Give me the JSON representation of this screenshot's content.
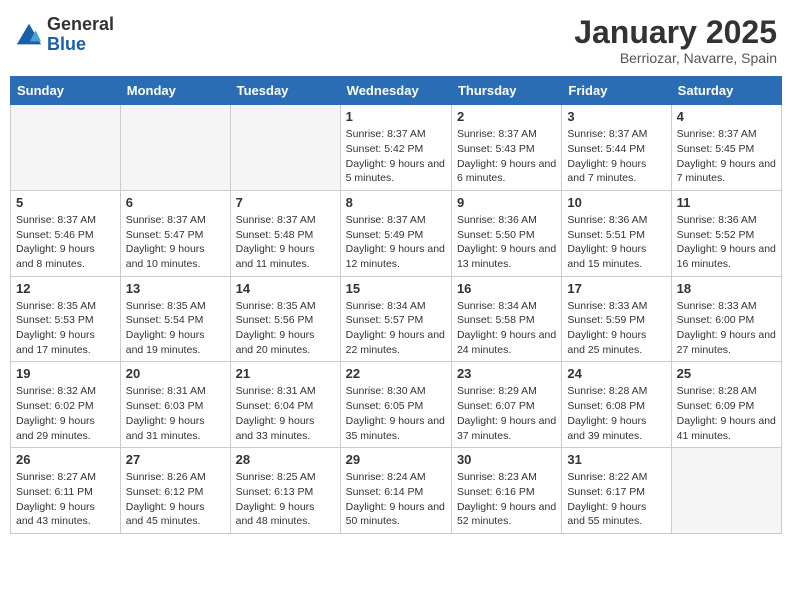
{
  "logo": {
    "general": "General",
    "blue": "Blue"
  },
  "title": "January 2025",
  "subtitle": "Berriozar, Navarre, Spain",
  "days": [
    "Sunday",
    "Monday",
    "Tuesday",
    "Wednesday",
    "Thursday",
    "Friday",
    "Saturday"
  ],
  "weeks": [
    [
      {
        "date": "",
        "sunrise": "",
        "sunset": "",
        "daylight": ""
      },
      {
        "date": "",
        "sunrise": "",
        "sunset": "",
        "daylight": ""
      },
      {
        "date": "",
        "sunrise": "",
        "sunset": "",
        "daylight": ""
      },
      {
        "date": "1",
        "sunrise": "Sunrise: 8:37 AM",
        "sunset": "Sunset: 5:42 PM",
        "daylight": "Daylight: 9 hours and 5 minutes."
      },
      {
        "date": "2",
        "sunrise": "Sunrise: 8:37 AM",
        "sunset": "Sunset: 5:43 PM",
        "daylight": "Daylight: 9 hours and 6 minutes."
      },
      {
        "date": "3",
        "sunrise": "Sunrise: 8:37 AM",
        "sunset": "Sunset: 5:44 PM",
        "daylight": "Daylight: 9 hours and 7 minutes."
      },
      {
        "date": "4",
        "sunrise": "Sunrise: 8:37 AM",
        "sunset": "Sunset: 5:45 PM",
        "daylight": "Daylight: 9 hours and 7 minutes."
      }
    ],
    [
      {
        "date": "5",
        "sunrise": "Sunrise: 8:37 AM",
        "sunset": "Sunset: 5:46 PM",
        "daylight": "Daylight: 9 hours and 8 minutes."
      },
      {
        "date": "6",
        "sunrise": "Sunrise: 8:37 AM",
        "sunset": "Sunset: 5:47 PM",
        "daylight": "Daylight: 9 hours and 10 minutes."
      },
      {
        "date": "7",
        "sunrise": "Sunrise: 8:37 AM",
        "sunset": "Sunset: 5:48 PM",
        "daylight": "Daylight: 9 hours and 11 minutes."
      },
      {
        "date": "8",
        "sunrise": "Sunrise: 8:37 AM",
        "sunset": "Sunset: 5:49 PM",
        "daylight": "Daylight: 9 hours and 12 minutes."
      },
      {
        "date": "9",
        "sunrise": "Sunrise: 8:36 AM",
        "sunset": "Sunset: 5:50 PM",
        "daylight": "Daylight: 9 hours and 13 minutes."
      },
      {
        "date": "10",
        "sunrise": "Sunrise: 8:36 AM",
        "sunset": "Sunset: 5:51 PM",
        "daylight": "Daylight: 9 hours and 15 minutes."
      },
      {
        "date": "11",
        "sunrise": "Sunrise: 8:36 AM",
        "sunset": "Sunset: 5:52 PM",
        "daylight": "Daylight: 9 hours and 16 minutes."
      }
    ],
    [
      {
        "date": "12",
        "sunrise": "Sunrise: 8:35 AM",
        "sunset": "Sunset: 5:53 PM",
        "daylight": "Daylight: 9 hours and 17 minutes."
      },
      {
        "date": "13",
        "sunrise": "Sunrise: 8:35 AM",
        "sunset": "Sunset: 5:54 PM",
        "daylight": "Daylight: 9 hours and 19 minutes."
      },
      {
        "date": "14",
        "sunrise": "Sunrise: 8:35 AM",
        "sunset": "Sunset: 5:56 PM",
        "daylight": "Daylight: 9 hours and 20 minutes."
      },
      {
        "date": "15",
        "sunrise": "Sunrise: 8:34 AM",
        "sunset": "Sunset: 5:57 PM",
        "daylight": "Daylight: 9 hours and 22 minutes."
      },
      {
        "date": "16",
        "sunrise": "Sunrise: 8:34 AM",
        "sunset": "Sunset: 5:58 PM",
        "daylight": "Daylight: 9 hours and 24 minutes."
      },
      {
        "date": "17",
        "sunrise": "Sunrise: 8:33 AM",
        "sunset": "Sunset: 5:59 PM",
        "daylight": "Daylight: 9 hours and 25 minutes."
      },
      {
        "date": "18",
        "sunrise": "Sunrise: 8:33 AM",
        "sunset": "Sunset: 6:00 PM",
        "daylight": "Daylight: 9 hours and 27 minutes."
      }
    ],
    [
      {
        "date": "19",
        "sunrise": "Sunrise: 8:32 AM",
        "sunset": "Sunset: 6:02 PM",
        "daylight": "Daylight: 9 hours and 29 minutes."
      },
      {
        "date": "20",
        "sunrise": "Sunrise: 8:31 AM",
        "sunset": "Sunset: 6:03 PM",
        "daylight": "Daylight: 9 hours and 31 minutes."
      },
      {
        "date": "21",
        "sunrise": "Sunrise: 8:31 AM",
        "sunset": "Sunset: 6:04 PM",
        "daylight": "Daylight: 9 hours and 33 minutes."
      },
      {
        "date": "22",
        "sunrise": "Sunrise: 8:30 AM",
        "sunset": "Sunset: 6:05 PM",
        "daylight": "Daylight: 9 hours and 35 minutes."
      },
      {
        "date": "23",
        "sunrise": "Sunrise: 8:29 AM",
        "sunset": "Sunset: 6:07 PM",
        "daylight": "Daylight: 9 hours and 37 minutes."
      },
      {
        "date": "24",
        "sunrise": "Sunrise: 8:28 AM",
        "sunset": "Sunset: 6:08 PM",
        "daylight": "Daylight: 9 hours and 39 minutes."
      },
      {
        "date": "25",
        "sunrise": "Sunrise: 8:28 AM",
        "sunset": "Sunset: 6:09 PM",
        "daylight": "Daylight: 9 hours and 41 minutes."
      }
    ],
    [
      {
        "date": "26",
        "sunrise": "Sunrise: 8:27 AM",
        "sunset": "Sunset: 6:11 PM",
        "daylight": "Daylight: 9 hours and 43 minutes."
      },
      {
        "date": "27",
        "sunrise": "Sunrise: 8:26 AM",
        "sunset": "Sunset: 6:12 PM",
        "daylight": "Daylight: 9 hours and 45 minutes."
      },
      {
        "date": "28",
        "sunrise": "Sunrise: 8:25 AM",
        "sunset": "Sunset: 6:13 PM",
        "daylight": "Daylight: 9 hours and 48 minutes."
      },
      {
        "date": "29",
        "sunrise": "Sunrise: 8:24 AM",
        "sunset": "Sunset: 6:14 PM",
        "daylight": "Daylight: 9 hours and 50 minutes."
      },
      {
        "date": "30",
        "sunrise": "Sunrise: 8:23 AM",
        "sunset": "Sunset: 6:16 PM",
        "daylight": "Daylight: 9 hours and 52 minutes."
      },
      {
        "date": "31",
        "sunrise": "Sunrise: 8:22 AM",
        "sunset": "Sunset: 6:17 PM",
        "daylight": "Daylight: 9 hours and 55 minutes."
      },
      {
        "date": "",
        "sunrise": "",
        "sunset": "",
        "daylight": ""
      }
    ]
  ]
}
